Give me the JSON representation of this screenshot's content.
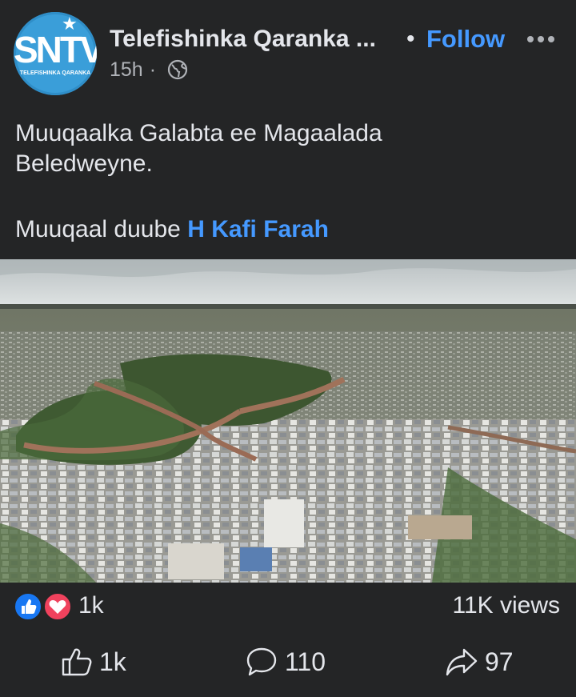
{
  "post": {
    "page_name": "Telefishinka Qaranka ...",
    "follow_label": "Follow",
    "time": "15h",
    "avatar": {
      "logo_text": "SNTV",
      "subtitle": "TELEFISHINKA QARANKA"
    },
    "text_line1": "Muuqaalka Galabta ee  Magaalada",
    "text_line2": "Beledweyne.",
    "text_prefix": "Muuqaal duube",
    "mention": "H Kafi Farah"
  },
  "stats": {
    "reaction_count": "1k",
    "views": "11K views"
  },
  "actions": {
    "like": "1k",
    "comment": "110",
    "share": "97"
  },
  "colors": {
    "background": "#242526",
    "link": "#4599ff",
    "avatar": "#3a9ed9"
  },
  "icons": [
    "more-icon",
    "globe-icon",
    "like-reaction-icon",
    "love-reaction-icon",
    "thumbs-up-icon",
    "comment-icon",
    "share-icon"
  ]
}
